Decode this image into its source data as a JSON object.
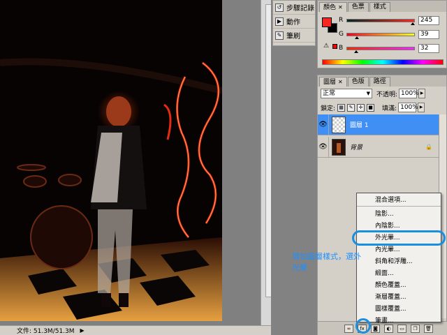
{
  "status_bar": {
    "doc_size": "文件: 51.3M/51.3M"
  },
  "mini_panel": {
    "items": [
      {
        "label": "步驟記錄",
        "icon": "history-icon"
      },
      {
        "label": "動作",
        "icon": "actions-icon"
      },
      {
        "label": "筆刷",
        "icon": "brush-icon"
      }
    ]
  },
  "color_panel": {
    "tabs": [
      "顏色",
      "色票",
      "樣式"
    ],
    "fg_color": "#f52720",
    "bg_color": "#000000",
    "r": {
      "label": "R",
      "value": "245"
    },
    "g": {
      "label": "G",
      "value": "39"
    },
    "b": {
      "label": "B",
      "value": "32"
    }
  },
  "layers_panel": {
    "tabs": [
      "圖層",
      "色版",
      "路徑"
    ],
    "blend_mode": "正常",
    "opacity_label": "不透明:",
    "opacity_value": "100%",
    "lock_label": "鎖定:",
    "fill_label": "填滿:",
    "fill_value": "100%",
    "layers": [
      {
        "name": "圖層 1",
        "selected": true
      },
      {
        "name": "背景",
        "selected": false
      }
    ]
  },
  "context_menu": {
    "items": [
      "混合選項...",
      "陰影...",
      "內陰影...",
      "外光暈...",
      "內光暈...",
      "斜角和浮雕...",
      "緞面...",
      "顏色覆蓋...",
      "漸層覆蓋...",
      "圖樣覆蓋...",
      "筆畫..."
    ]
  },
  "annotation": {
    "text": "增加圖層樣式，選外光暈"
  }
}
